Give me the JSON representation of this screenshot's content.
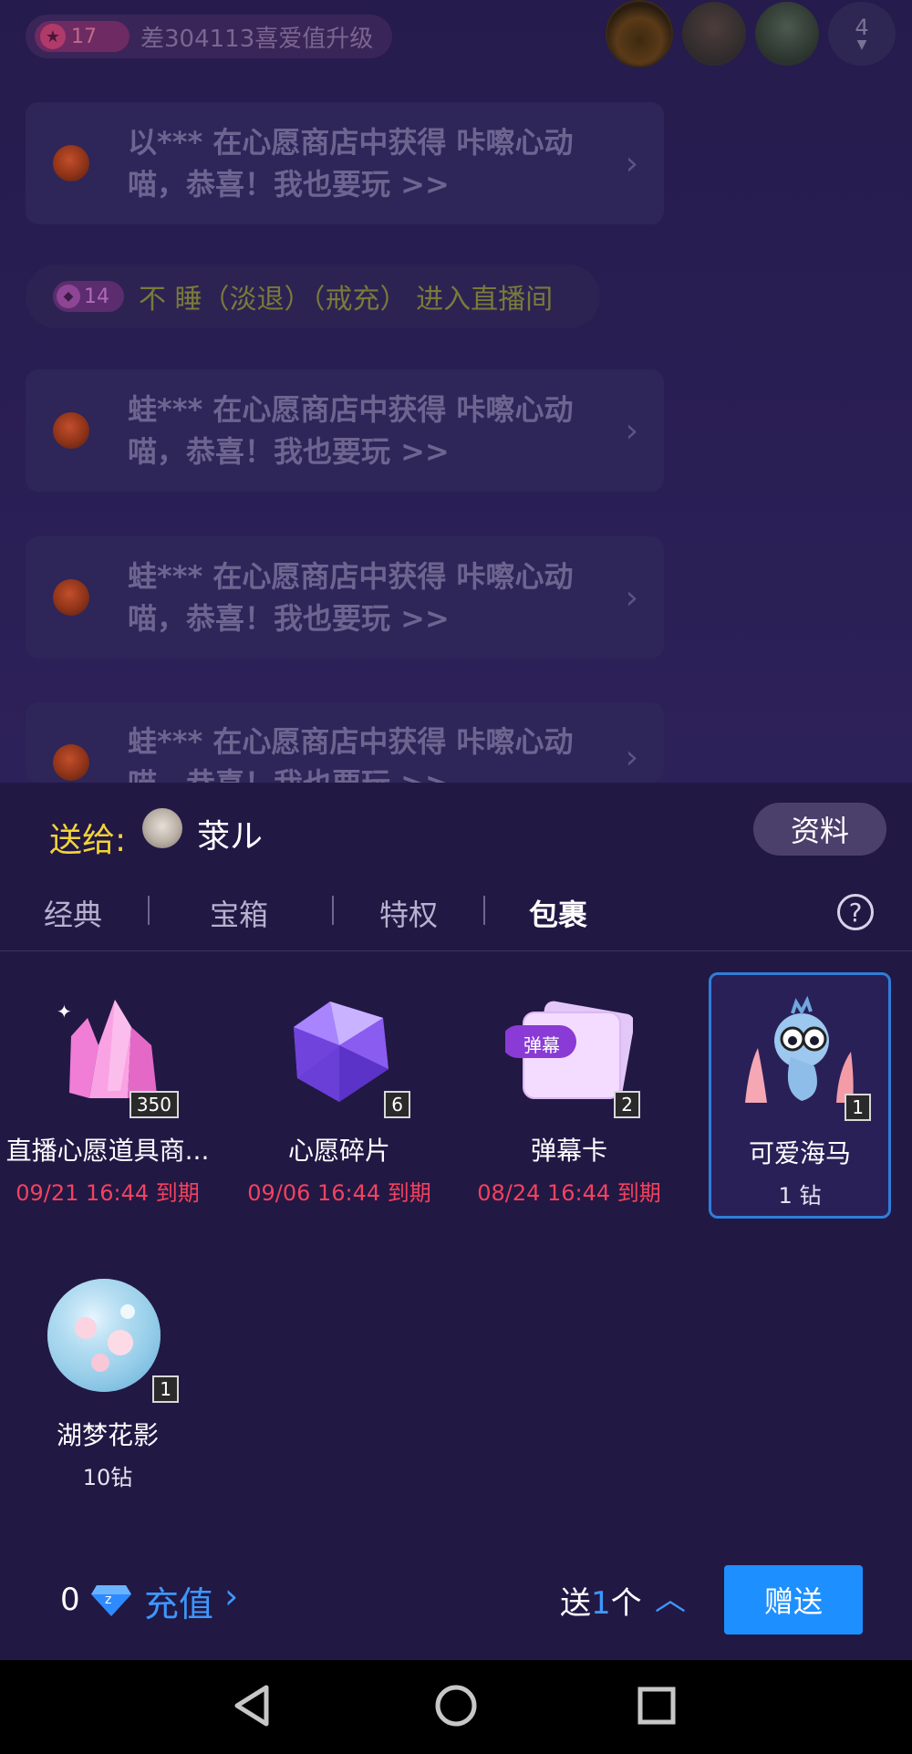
{
  "header": {
    "level": "17",
    "level_text": "差304113喜爱值升级",
    "viewer_count": "4"
  },
  "chat": {
    "messages": [
      {
        "text": "以*** 在心愿商店中获得 咔嚓心动喵，恭喜！我也要玩 >>"
      },
      {
        "text": "蛙*** 在心愿商店中获得 咔嚓心动喵，恭喜！我也要玩 >>"
      },
      {
        "text": "蛙*** 在心愿商店中获得 咔嚓心动喵，恭喜！我也要玩 >>"
      },
      {
        "text": "蛙*** 在心愿商店中获得 咔嚓心动喵，恭喜！我也要玩 >>"
      }
    ],
    "enter_level": "14",
    "enter_text": "不 睡（淡退）（戒充） 进入直播间"
  },
  "gift_panel": {
    "to_label": "送给:",
    "to_name": "莍ル",
    "profile_button": "资料",
    "tabs": [
      "经典",
      "宝箱",
      "特权",
      "包裹"
    ],
    "active_tab": "包裹",
    "gifts": [
      {
        "name": "直播心愿道具商...",
        "qty": "350",
        "sub": "09/21 16:44 到期",
        "icon": "pink-crystal-icon"
      },
      {
        "name": "心愿碎片",
        "qty": "6",
        "sub": "09/06 16:44 到期",
        "icon": "purple-gem-icon"
      },
      {
        "name": "弹幕卡",
        "qty": "2",
        "sub": "08/24 16:44 到期",
        "icon": "danmaku-card-icon",
        "card_label": "弹幕"
      },
      {
        "name": "可爱海马",
        "qty": "1",
        "sub": "1 钻",
        "icon": "seahorse-icon",
        "selected": true
      },
      {
        "name": "湖梦花影",
        "qty": "1",
        "sub": "10钻",
        "icon": "flower-orb-icon"
      }
    ]
  },
  "footer": {
    "balance": "0",
    "recharge": "充值",
    "send_prefix": "送",
    "send_num": "1",
    "send_suffix": "个",
    "give_button": "赠送"
  },
  "colors": {
    "accent_blue": "#1e8fff",
    "expiry_red": "#f2425e",
    "to_label_yellow": "#f3d339"
  }
}
